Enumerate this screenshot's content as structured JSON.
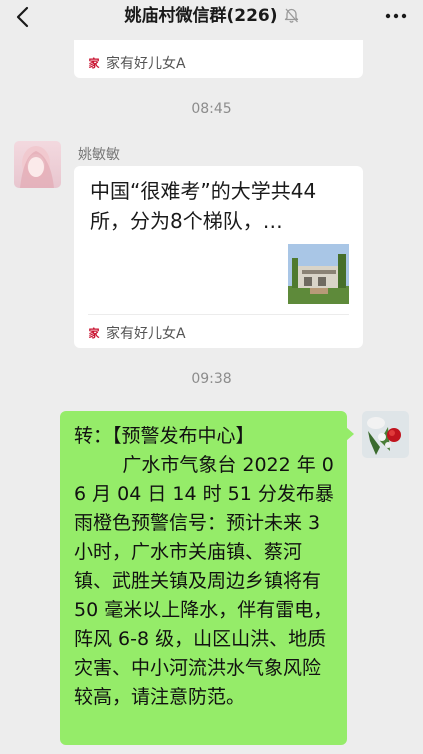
{
  "header": {
    "title": "姚庙村微信群(226)",
    "icons": [
      "back-arrow-icon",
      "mute-bell-icon",
      "more-dots-icon"
    ]
  },
  "messages": {
    "card_top": {
      "source": "家有好儿女A"
    },
    "time1": "08:45",
    "card_link": {
      "sender": "姚敏敏",
      "title": "中国“很难考”的大学共44所，分为8个梯队，…",
      "source": "家有好儿女A"
    },
    "time2": "09:38",
    "own_message": {
      "text": "转：【预警发布中心】\n        广水市气象台 2022 年 06 月 04 日 14 时 51 分发布暴雨橙色预警信号：预计未来 3 小时，广水市关庙镇、蔡河镇、武胜关镇及周边乡镇将有 50 毫米以上降水，伴有雷电，阵风 6-8 级，山区山洪、地质灾害、中小河流洪水气象风险较高，请注意防范。"
    }
  },
  "colors": {
    "background": "#ededed",
    "own_bubble": "#95ec69",
    "card": "#ffffff",
    "source_icon": "#c8102e"
  }
}
